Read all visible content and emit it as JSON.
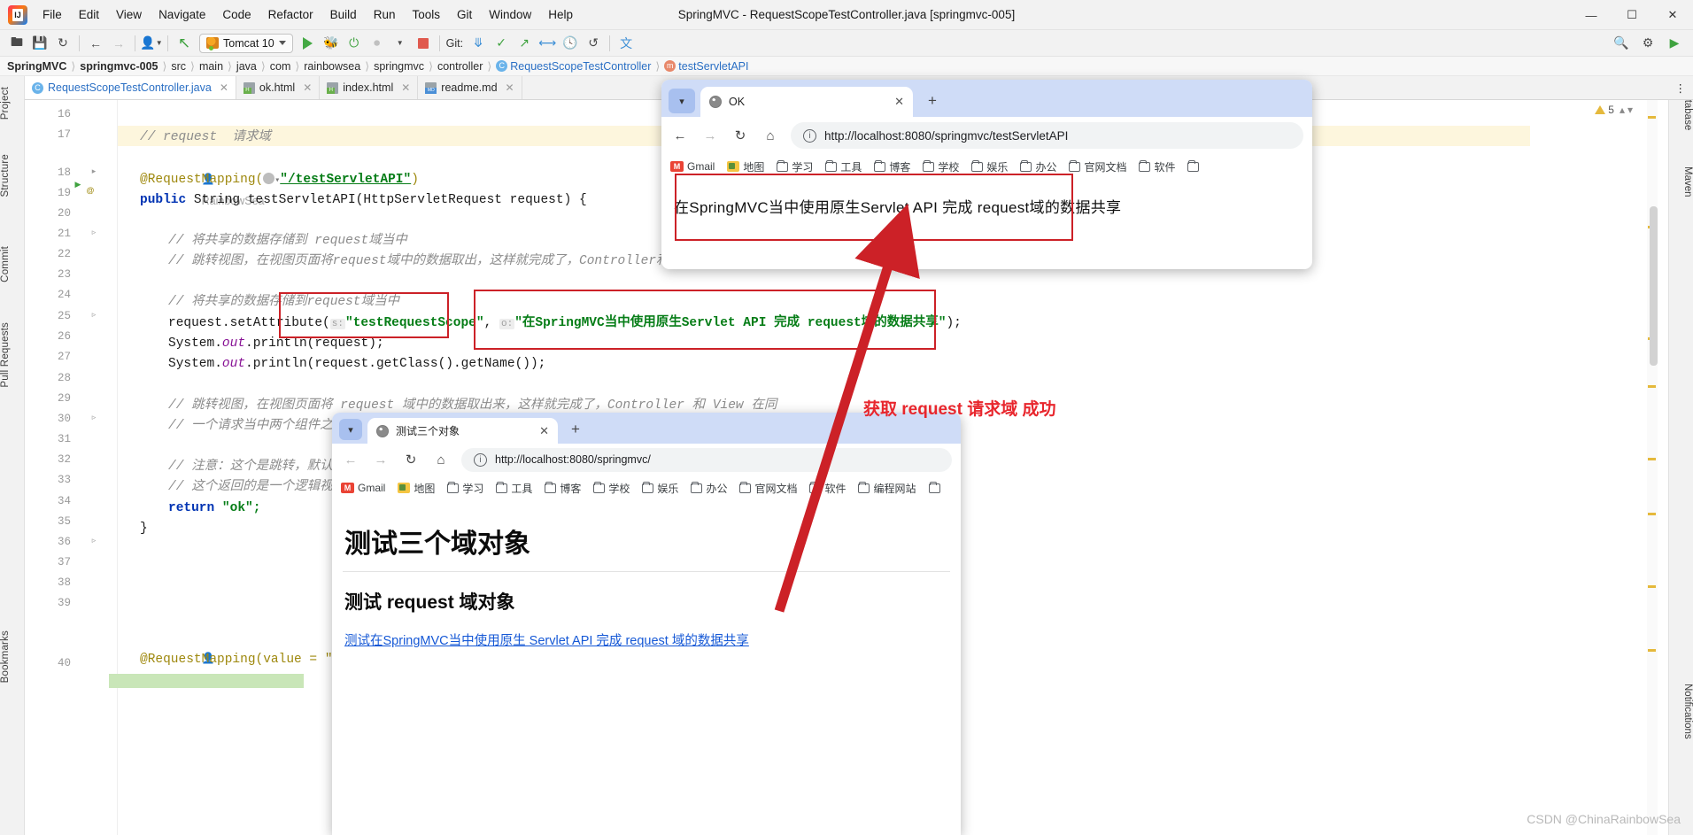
{
  "ide": {
    "window_title": "SpringMVC - RequestScopeTestController.java [springmvc-005]",
    "menu": [
      "File",
      "Edit",
      "View",
      "Navigate",
      "Code",
      "Refactor",
      "Build",
      "Run",
      "Tools",
      "Git",
      "Window",
      "Help"
    ],
    "window_controls": {
      "minimize": "—",
      "maximize": "☐",
      "close": "✕"
    },
    "toolbar": {
      "run_config": "Tomcat 10",
      "git_label": "Git:",
      "icons": [
        "open-folder-icon",
        "save-icon",
        "sync-icon",
        "back-arrow-icon",
        "forward-arrow-icon",
        "profile-icon",
        "update-project-icon",
        "run-icon",
        "debug-icon",
        "run-coverage-icon",
        "profiler-icon",
        "stop-icon",
        "git-update-icon",
        "git-commit-icon",
        "git-push-icon",
        "git-history-icon",
        "git-rollback-icon",
        "translate-icon"
      ],
      "right_icons": [
        "search-icon",
        "settings-icon",
        "run-green-icon"
      ]
    },
    "breadcrumb": [
      {
        "label": "SpringMVC",
        "bold": true
      },
      {
        "label": "springmvc-005",
        "bold": true
      },
      {
        "label": "src"
      },
      {
        "label": "main"
      },
      {
        "label": "java"
      },
      {
        "label": "com"
      },
      {
        "label": "rainbowsea"
      },
      {
        "label": "springmvc"
      },
      {
        "label": "controller"
      },
      {
        "label": "RequestScopeTestController",
        "link": true,
        "icon": "C"
      },
      {
        "label": "testServletAPI",
        "link": true,
        "icon": "m"
      }
    ],
    "file_tabs": [
      {
        "label": "RequestScopeTestController.java",
        "icon": "java",
        "active": true
      },
      {
        "label": "ok.html",
        "icon": "html",
        "active": false
      },
      {
        "label": "index.html",
        "icon": "html",
        "active": false
      },
      {
        "label": "readme.md",
        "icon": "md",
        "active": false
      }
    ],
    "left_tools": [
      "Project",
      "Structure",
      "Commit",
      "Pull Requests",
      "Bookmarks"
    ],
    "right_tools": [
      "Database",
      "Maven",
      "Notifications"
    ],
    "warning_count": "5",
    "editor": {
      "line_numbers": [
        "16",
        "17",
        "18",
        "19",
        "20",
        "21",
        "22",
        "23",
        "24",
        "25",
        "26",
        "27",
        "28",
        "29",
        "30",
        "31",
        "32",
        "33",
        "34",
        "35",
        "36",
        "37",
        "38",
        "39",
        "40"
      ],
      "lines": [
        {
          "n": "16",
          "text": ""
        },
        {
          "n": "17",
          "text": "// request  请求域",
          "type": "comment",
          "highlight": true
        },
        {
          "n": "17b",
          "text": "RainbowSea",
          "type": "author"
        },
        {
          "n": "18",
          "text": "@RequestMapping(\"/testServletAPI\")",
          "type": "annotation"
        },
        {
          "n": "19",
          "text": "public String testServletAPI(HttpServletRequest request) {",
          "type": "signature"
        },
        {
          "n": "20",
          "text": ""
        },
        {
          "n": "21",
          "text": "// 将共享的数据存储到 request域当中",
          "type": "comment"
        },
        {
          "n": "22",
          "text": "// 跳转视图，在视图页面将request域中的数据取出，这样就完成了，Controller和Vi",
          "type": "comment"
        },
        {
          "n": "23",
          "text": ""
        },
        {
          "n": "24",
          "text": "// 将共享的数据存储到request域当中",
          "type": "comment"
        },
        {
          "n": "25",
          "text": "request.setAttribute( s: \"testRequestScope\",  o: \"在SpringMVC当中使用原生Servlet API 完成 request域的数据共享\");",
          "type": "code"
        },
        {
          "n": "26",
          "text": "System.out.println(request);",
          "type": "code"
        },
        {
          "n": "27",
          "text": "System.out.println(request.getClass().getName());",
          "type": "code"
        },
        {
          "n": "28",
          "text": ""
        },
        {
          "n": "29",
          "text": "// 跳转视图，在视图页面将 request 域中的数据取出来，这样就完成了，Controller 和 View 在同",
          "type": "comment"
        },
        {
          "n": "30",
          "text": "// 一个请求当中两个组件之间",
          "type": "comment"
        },
        {
          "n": "31",
          "text": ""
        },
        {
          "n": "32",
          "text": "// 注意：这个是跳转，默认情",
          "type": "comment"
        },
        {
          "n": "33",
          "text": "// 这个返回的是一个逻辑视图",
          "type": "comment"
        },
        {
          "n": "34",
          "text": "return \"ok\";",
          "type": "code"
        },
        {
          "n": "35",
          "text": "}",
          "type": "code"
        },
        {
          "n": "36",
          "text": ""
        },
        {
          "n": "37",
          "text": ""
        },
        {
          "n": "38",
          "text": ""
        },
        {
          "n": "39",
          "text": ""
        },
        {
          "n": "39b",
          "text": "RainbowSea",
          "type": "author"
        },
        {
          "n": "40",
          "text": "@RequestMapping(value = \"/",
          "type": "annotation"
        }
      ],
      "code_tokens": {
        "comment_17": "// request  请求域",
        "author": "RainbowSea",
        "anno_18_pre": "@RequestMapping(",
        "anno_18_str": "\"/testServletAPI\"",
        "anno_18_post": ")",
        "sig_kw": "public",
        "sig_rest": " String testServletAPI(HttpServletRequest request) {",
        "comment_21": "// 将共享的数据存储到 request域当中",
        "comment_22": "// 跳转视图，在视图页面将request域中的数据取出，这样就完成了，Controller和Vi",
        "comment_24": "// 将共享的数据存储到request域当中",
        "line25_call": "request.setAttribute(",
        "line25_hint_s": "s:",
        "line25_key": "\"testRequestScope\"",
        "line25_comma": ", ",
        "line25_hint_o": "o:",
        "line25_value": "\"在SpringMVC当中使用原生Servlet API 完成 request域的数据共享\"",
        "line25_end": ");",
        "line26": "System.out.println(request);",
        "line27": "System.out.println(request.getClass().getName());",
        "comment_29": "// 跳转视图，在视图页面将 request 域中的数据取出来，这样就完成了，Controller 和 View 在同",
        "comment_30": "// 一个请求当中两个组件之间",
        "comment_32": "// 注意：这个是跳转，默认情",
        "comment_33": "// 这个返回的是一个逻辑视图",
        "line34_kw": "return",
        "line34_str": " \"ok\";",
        "line35": "}",
        "line40": "@RequestMapping(value = \"/"
      }
    }
  },
  "browser_top": {
    "tab_title": "OK",
    "tab_close": "✕",
    "new_tab": "+",
    "nav": {
      "back": "←",
      "forward": "→",
      "reload": "↻",
      "home": "⌂"
    },
    "url": "http://localhost:8080/springmvc/testServletAPI",
    "bookmarks": [
      "Gmail",
      "地图",
      "学习",
      "工具",
      "博客",
      "学校",
      "娱乐",
      "办公",
      "官网文档",
      "软件",
      ""
    ],
    "page_text": "在SpringMVC当中使用原生Servlet API 完成 request域的数据共享"
  },
  "browser_bottom": {
    "tab_title": "测试三个对象",
    "tab_close": "✕",
    "new_tab": "+",
    "nav": {
      "back": "←",
      "forward": "→",
      "reload": "↻",
      "home": "⌂"
    },
    "url": "http://localhost:8080/springmvc/",
    "bookmarks": [
      "Gmail",
      "地图",
      "学习",
      "工具",
      "博客",
      "学校",
      "娱乐",
      "办公",
      "官网文档",
      "软件",
      "编程网站",
      ""
    ],
    "h1": "测试三个域对象",
    "h2": "测试 request 域对象",
    "link": "测试在SpringMVC当中使用原生 Servlet API 完成 request 域的数据共享"
  },
  "annotations": {
    "success_text": "获取 request 请求域 成功",
    "watermark": "CSDN @ChinaRainbowSea",
    "accent_red": "#cc2127",
    "arrow_color": "#cc2127"
  }
}
